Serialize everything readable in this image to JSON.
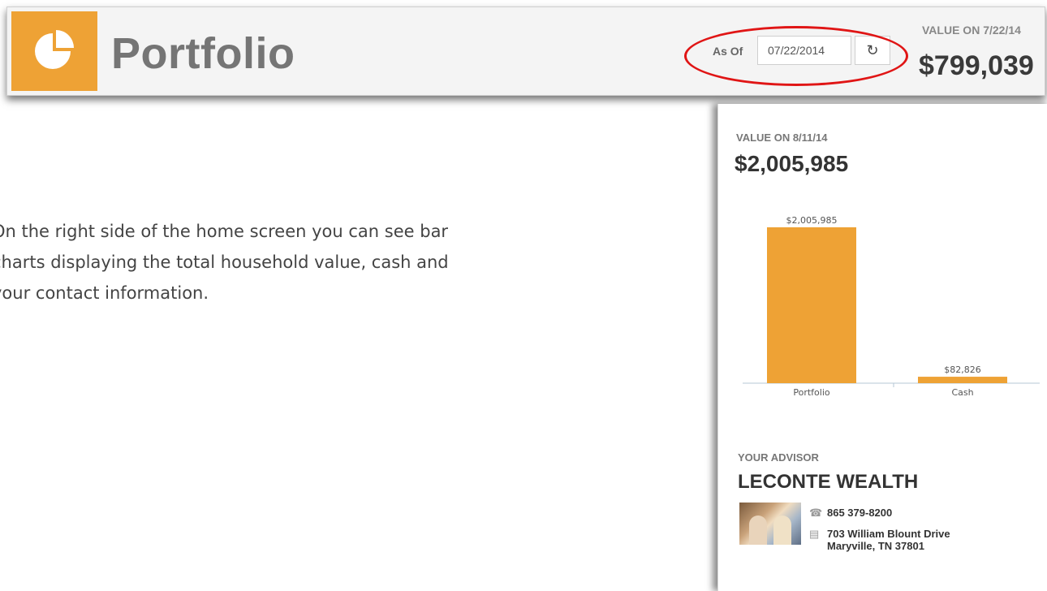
{
  "header": {
    "title": "Portfolio",
    "logo_icon": "pie-chart-icon",
    "accent_color": "#eea235",
    "as_of_label": "As Of",
    "date_value": "07/22/2014",
    "refresh_icon": "refresh-icon",
    "value_label": "VALUE ON 7/22/14",
    "value": "$799,039",
    "highlight_color": "#e01515"
  },
  "instructions": {
    "text": "On the right side of the home screen you can see bar\ncharts displaying the total household value, cash and\nyour contact information."
  },
  "side_panel": {
    "value_label": "VALUE ON 8/11/14",
    "value": "$2,005,985",
    "advisor_label": "YOUR ADVISOR",
    "advisor_name": "LECONTE WEALTH",
    "phone": "865 379-8200",
    "phone_icon": "phone-icon",
    "address_line1": "703 William Blount Drive",
    "address_line2": "Maryville, TN 37801",
    "address_icon": "building-icon"
  },
  "chart_data": {
    "type": "bar",
    "categories": [
      "Portfolio",
      "Cash"
    ],
    "values": [
      2005985,
      82826
    ],
    "data_labels": [
      "$2,005,985",
      "$82,826"
    ],
    "ylim": [
      0,
      2005985
    ],
    "bar_color": "#eea235",
    "grid": false,
    "title": "",
    "xlabel": "",
    "ylabel": ""
  }
}
